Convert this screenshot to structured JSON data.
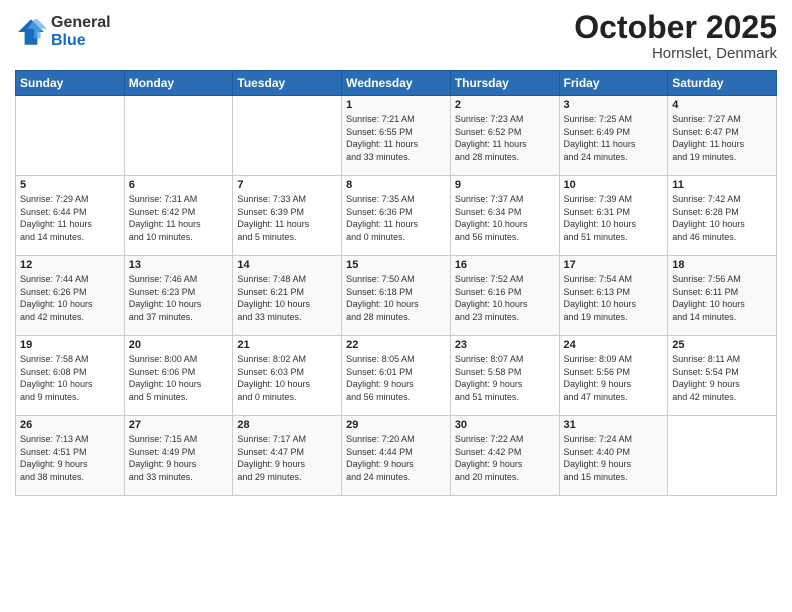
{
  "logo": {
    "general": "General",
    "blue": "Blue"
  },
  "title": "October 2025",
  "location": "Hornslet, Denmark",
  "days_header": [
    "Sunday",
    "Monday",
    "Tuesday",
    "Wednesday",
    "Thursday",
    "Friday",
    "Saturday"
  ],
  "weeks": [
    [
      {
        "day": "",
        "info": ""
      },
      {
        "day": "",
        "info": ""
      },
      {
        "day": "",
        "info": ""
      },
      {
        "day": "1",
        "info": "Sunrise: 7:21 AM\nSunset: 6:55 PM\nDaylight: 11 hours\nand 33 minutes."
      },
      {
        "day": "2",
        "info": "Sunrise: 7:23 AM\nSunset: 6:52 PM\nDaylight: 11 hours\nand 28 minutes."
      },
      {
        "day": "3",
        "info": "Sunrise: 7:25 AM\nSunset: 6:49 PM\nDaylight: 11 hours\nand 24 minutes."
      },
      {
        "day": "4",
        "info": "Sunrise: 7:27 AM\nSunset: 6:47 PM\nDaylight: 11 hours\nand 19 minutes."
      }
    ],
    [
      {
        "day": "5",
        "info": "Sunrise: 7:29 AM\nSunset: 6:44 PM\nDaylight: 11 hours\nand 14 minutes."
      },
      {
        "day": "6",
        "info": "Sunrise: 7:31 AM\nSunset: 6:42 PM\nDaylight: 11 hours\nand 10 minutes."
      },
      {
        "day": "7",
        "info": "Sunrise: 7:33 AM\nSunset: 6:39 PM\nDaylight: 11 hours\nand 5 minutes."
      },
      {
        "day": "8",
        "info": "Sunrise: 7:35 AM\nSunset: 6:36 PM\nDaylight: 11 hours\nand 0 minutes."
      },
      {
        "day": "9",
        "info": "Sunrise: 7:37 AM\nSunset: 6:34 PM\nDaylight: 10 hours\nand 56 minutes."
      },
      {
        "day": "10",
        "info": "Sunrise: 7:39 AM\nSunset: 6:31 PM\nDaylight: 10 hours\nand 51 minutes."
      },
      {
        "day": "11",
        "info": "Sunrise: 7:42 AM\nSunset: 6:28 PM\nDaylight: 10 hours\nand 46 minutes."
      }
    ],
    [
      {
        "day": "12",
        "info": "Sunrise: 7:44 AM\nSunset: 6:26 PM\nDaylight: 10 hours\nand 42 minutes."
      },
      {
        "day": "13",
        "info": "Sunrise: 7:46 AM\nSunset: 6:23 PM\nDaylight: 10 hours\nand 37 minutes."
      },
      {
        "day": "14",
        "info": "Sunrise: 7:48 AM\nSunset: 6:21 PM\nDaylight: 10 hours\nand 33 minutes."
      },
      {
        "day": "15",
        "info": "Sunrise: 7:50 AM\nSunset: 6:18 PM\nDaylight: 10 hours\nand 28 minutes."
      },
      {
        "day": "16",
        "info": "Sunrise: 7:52 AM\nSunset: 6:16 PM\nDaylight: 10 hours\nand 23 minutes."
      },
      {
        "day": "17",
        "info": "Sunrise: 7:54 AM\nSunset: 6:13 PM\nDaylight: 10 hours\nand 19 minutes."
      },
      {
        "day": "18",
        "info": "Sunrise: 7:56 AM\nSunset: 6:11 PM\nDaylight: 10 hours\nand 14 minutes."
      }
    ],
    [
      {
        "day": "19",
        "info": "Sunrise: 7:58 AM\nSunset: 6:08 PM\nDaylight: 10 hours\nand 9 minutes."
      },
      {
        "day": "20",
        "info": "Sunrise: 8:00 AM\nSunset: 6:06 PM\nDaylight: 10 hours\nand 5 minutes."
      },
      {
        "day": "21",
        "info": "Sunrise: 8:02 AM\nSunset: 6:03 PM\nDaylight: 10 hours\nand 0 minutes."
      },
      {
        "day": "22",
        "info": "Sunrise: 8:05 AM\nSunset: 6:01 PM\nDaylight: 9 hours\nand 56 minutes."
      },
      {
        "day": "23",
        "info": "Sunrise: 8:07 AM\nSunset: 5:58 PM\nDaylight: 9 hours\nand 51 minutes."
      },
      {
        "day": "24",
        "info": "Sunrise: 8:09 AM\nSunset: 5:56 PM\nDaylight: 9 hours\nand 47 minutes."
      },
      {
        "day": "25",
        "info": "Sunrise: 8:11 AM\nSunset: 5:54 PM\nDaylight: 9 hours\nand 42 minutes."
      }
    ],
    [
      {
        "day": "26",
        "info": "Sunrise: 7:13 AM\nSunset: 4:51 PM\nDaylight: 9 hours\nand 38 minutes."
      },
      {
        "day": "27",
        "info": "Sunrise: 7:15 AM\nSunset: 4:49 PM\nDaylight: 9 hours\nand 33 minutes."
      },
      {
        "day": "28",
        "info": "Sunrise: 7:17 AM\nSunset: 4:47 PM\nDaylight: 9 hours\nand 29 minutes."
      },
      {
        "day": "29",
        "info": "Sunrise: 7:20 AM\nSunset: 4:44 PM\nDaylight: 9 hours\nand 24 minutes."
      },
      {
        "day": "30",
        "info": "Sunrise: 7:22 AM\nSunset: 4:42 PM\nDaylight: 9 hours\nand 20 minutes."
      },
      {
        "day": "31",
        "info": "Sunrise: 7:24 AM\nSunset: 4:40 PM\nDaylight: 9 hours\nand 15 minutes."
      },
      {
        "day": "",
        "info": ""
      }
    ]
  ]
}
